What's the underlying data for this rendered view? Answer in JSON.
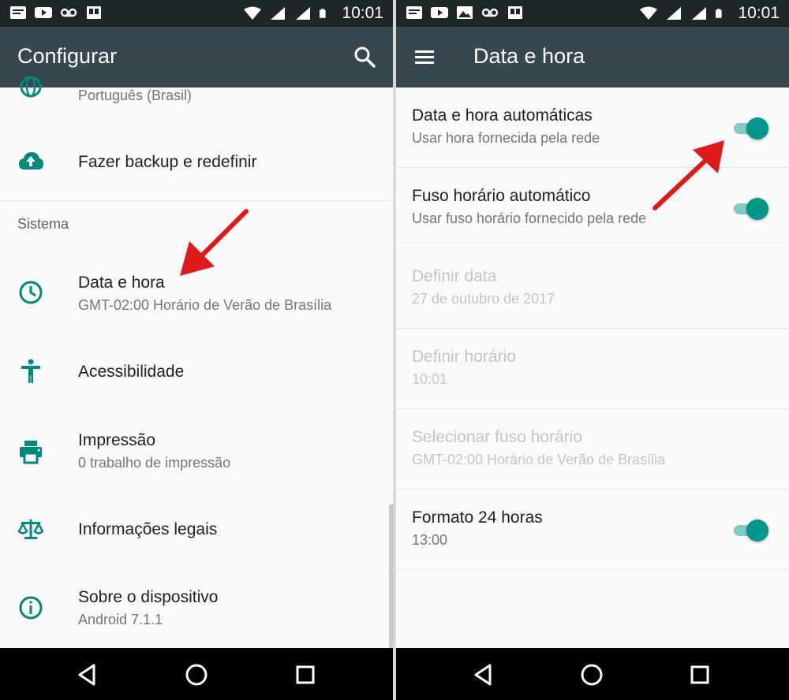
{
  "status_bar": {
    "time": "10:01"
  },
  "left": {
    "toolbar_title": "Configurar",
    "partial_item": "Português (Brasil)",
    "backup": "Fazer backup e redefinir",
    "section": "Sistema",
    "items": [
      {
        "title": "Data e hora",
        "subtitle": "GMT-02:00 Horário de Verão de Brasília"
      },
      {
        "title": "Acessibilidade"
      },
      {
        "title": "Impressão",
        "subtitle": "0 trabalho de impressão"
      },
      {
        "title": "Informações legais"
      },
      {
        "title": "Sobre o dispositivo",
        "subtitle": "Android 7.1.1"
      }
    ]
  },
  "right": {
    "toolbar_title": "Data e hora",
    "rows": [
      {
        "title": "Data e hora automáticas",
        "subtitle": "Usar hora fornecida pela rede",
        "toggle": true,
        "enabled": true
      },
      {
        "title": "Fuso horário automático",
        "subtitle": "Usar fuso horário fornecido pela rede",
        "toggle": true,
        "enabled": true
      },
      {
        "title": "Definir data",
        "subtitle": "27 de outubro de 2017",
        "enabled": false
      },
      {
        "title": "Definir horário",
        "subtitle": "10:01",
        "enabled": false
      },
      {
        "title": "Selecionar fuso horário",
        "subtitle": "GMT-02:00 Horário de Verão de Brasília",
        "enabled": false
      },
      {
        "title": "Formato 24 horas",
        "subtitle": "13:00",
        "toggle": true,
        "enabled": true
      }
    ]
  },
  "colors": {
    "accent": "#009688",
    "toolbar": "#37474f",
    "statusbar": "#1f2628",
    "annotation_arrow": "#e0191d"
  },
  "icons": {
    "left_list": [
      "globe-icon",
      "cloud-upload-icon",
      "clock-icon",
      "accessibility-icon",
      "printer-icon",
      "scales-icon",
      "info-icon"
    ],
    "nav": [
      "back-icon",
      "home-icon",
      "recents-icon"
    ]
  }
}
